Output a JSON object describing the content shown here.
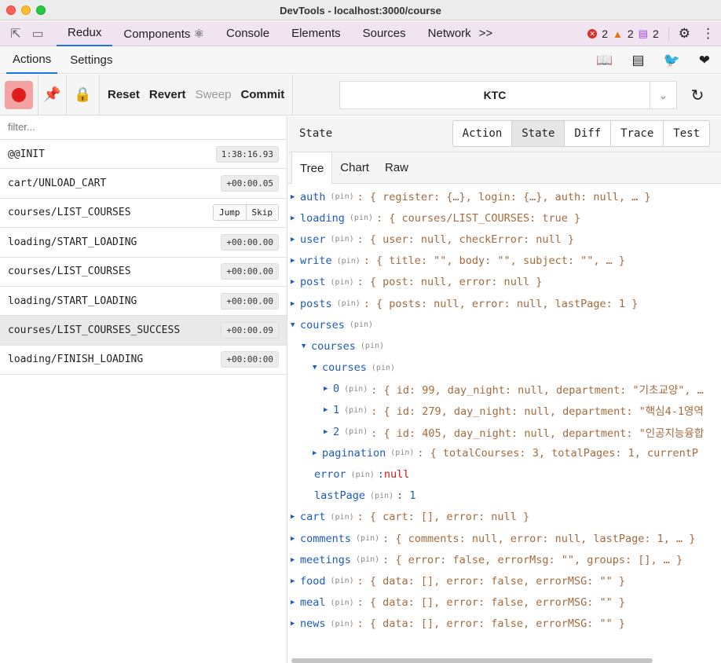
{
  "window": {
    "title": "DevTools - localhost:3000/course"
  },
  "devtools": {
    "tabs": [
      "Redux",
      "Components ⚛",
      "Console",
      "Elements",
      "Sources",
      "Network",
      ">>"
    ],
    "errors": "2",
    "warnings": "2",
    "messages": "2"
  },
  "redux": {
    "subtabs": [
      "Actions",
      "Settings"
    ],
    "toolbar": {
      "reset": "Reset",
      "revert": "Revert",
      "sweep": "Sweep",
      "commit": "Commit",
      "instance": "KTC"
    },
    "filter_placeholder": "filter...",
    "actions": [
      {
        "name": "@@INIT",
        "time": "1:38:16.93"
      },
      {
        "name": "cart/UNLOAD_CART",
        "time": "+00:00.05"
      },
      {
        "name": "courses/LIST_COURSES",
        "jump": "Jump",
        "skip": "Skip"
      },
      {
        "name": "loading/START_LOADING",
        "time": "+00:00.00"
      },
      {
        "name": "courses/LIST_COURSES",
        "time": "+00:00.00"
      },
      {
        "name": "loading/START_LOADING",
        "time": "+00:00.00"
      },
      {
        "name": "courses/LIST_COURSES_SUCCESS",
        "time": "+00:00.09"
      },
      {
        "name": "loading/FINISH_LOADING",
        "time": "+00:00:00"
      }
    ],
    "state_label": "State",
    "mode_tabs": [
      "Action",
      "State",
      "Diff",
      "Trace",
      "Test"
    ],
    "view_tabs": [
      "Tree",
      "Chart",
      "Raw"
    ],
    "pin": "(pin)",
    "tree": [
      {
        "key": "auth",
        "preview": ": { register: {…}, login: {…}, auth: null, … }"
      },
      {
        "key": "loading",
        "preview": ": { courses/LIST_COURSES: true }"
      },
      {
        "key": "user",
        "preview": ": { user: null, checkError: null }"
      },
      {
        "key": "write",
        "preview": ": { title: \"\", body: \"\", subject: \"\", … }"
      },
      {
        "key": "post",
        "preview": ": { post: null, error: null }"
      },
      {
        "key": "posts",
        "preview": ": { posts: null, error: null, lastPage: 1 }"
      },
      {
        "key": "courses",
        "preview": ""
      },
      {
        "key": "courses",
        "preview": ""
      },
      {
        "key": "courses",
        "preview": ""
      },
      {
        "key": "0",
        "preview": ": { id: 99, day_night: null, department: \"기초교양\", …"
      },
      {
        "key": "1",
        "preview": ": { id: 279, day_night: null, department: \"핵심4-1영역"
      },
      {
        "key": "2",
        "preview": ": { id: 405, day_night: null, department: \"인공지능융합"
      },
      {
        "key": "pagination",
        "preview": ": { totalCourses: 3, totalPages: 1, currentP"
      },
      {
        "key": "error",
        "preview": ": ",
        "value": "null"
      },
      {
        "key": "lastPage",
        "preview": ": 1"
      },
      {
        "key": "cart",
        "preview": ": { cart: [], error: null }"
      },
      {
        "key": "comments",
        "preview": ": { comments: null, error: null, lastPage: 1, … }"
      },
      {
        "key": "meetings",
        "preview": ": { error: false, errorMsg: \"\", groups: [], … }"
      },
      {
        "key": "food",
        "preview": ": { data: [], error: false, errorMSG: \"\" }"
      },
      {
        "key": "meal",
        "preview": ": { data: [], error: false, errorMSG: \"\" }"
      },
      {
        "key": "news",
        "preview": ": { data: [], error: false, errorMSG: \"\" }"
      }
    ]
  }
}
